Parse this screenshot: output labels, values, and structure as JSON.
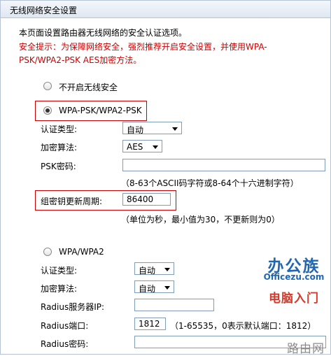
{
  "header": {
    "title": "无线网络安全设置"
  },
  "intro": {
    "description": "本页面设置路由器无线网络的安全认证选项。",
    "warning_line1": "安全提示：为保障网络安全，强烈推荐开启安全设置，并使用WPA-",
    "warning_line2": "PSK/WPA2-PSK AES加密方法。"
  },
  "options": {
    "disable": {
      "label": "不开启无线安全",
      "checked": false
    },
    "wpa_psk": {
      "label": "WPA-PSK/WPA2-PSK",
      "checked": true,
      "auth_type_label": "认证类型:",
      "auth_type_value": "自动",
      "encryption_label": "加密算法:",
      "encryption_value": "AES",
      "psk_label": "PSK密码:",
      "psk_value": "",
      "psk_hint": "（8-63个ASCII码字符或8-64个十六进制字符）",
      "group_key_label": "组密钥更新周期:",
      "group_key_value": "86400",
      "group_key_hint": "（单位为秒，最小值为30，不更新则为0）"
    },
    "wpa": {
      "label": "WPA/WPA2",
      "checked": false,
      "auth_type_label": "认证类型:",
      "auth_type_value": "自动",
      "encryption_label": "加密算法:",
      "encryption_value": "自动",
      "radius_ip_label": "Radius服务器IP:",
      "radius_ip_value": "",
      "radius_port_label": "Radius端口:",
      "radius_port_value": "1812",
      "radius_port_hint": "（1-65535，0表示默认端口：1812）",
      "radius_password_label": "Radius密码:",
      "radius_password_value": ""
    }
  },
  "watermark": {
    "brand": "办公族",
    "domain": "Officezu.com",
    "tagline": "电脑入门",
    "corner": "路由网"
  },
  "colors": {
    "warning": "#cc0000",
    "header_border": "#b5c3d4",
    "brand_blue": "#1f67b3",
    "brand_red": "#d63a2a"
  }
}
